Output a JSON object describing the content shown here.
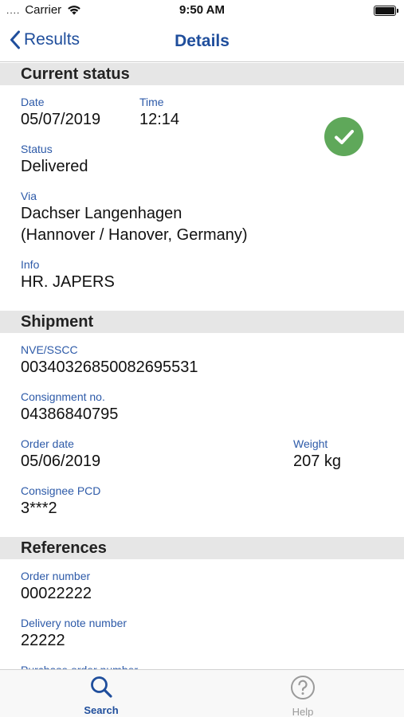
{
  "status_bar": {
    "dots": "....",
    "carrier": "Carrier",
    "time": "9:50 AM"
  },
  "nav": {
    "back_label": "Results",
    "title": "Details"
  },
  "current_status": {
    "header": "Current status",
    "date_label": "Date",
    "date_value": "05/07/2019",
    "time_label": "Time",
    "time_value": "12:14",
    "status_label": "Status",
    "status_value": "Delivered",
    "via_label": "Via",
    "via_line1": "Dachser Langenhagen",
    "via_line2": "(Hannover / Hanover, Germany)",
    "info_label": "Info",
    "info_value": "HR. JAPERS"
  },
  "shipment": {
    "header": "Shipment",
    "nve_label": "NVE/SSCC",
    "nve_value": "00340326850082695531",
    "consignment_label": "Consignment no.",
    "consignment_value": "04386840795",
    "order_date_label": "Order date",
    "order_date_value": "05/06/2019",
    "weight_label": "Weight",
    "weight_value": "207 kg",
    "pcd_label": "Consignee PCD",
    "pcd_value": "3***2"
  },
  "references": {
    "header": "References",
    "order_number_label": "Order number",
    "order_number_value": "00022222",
    "delivery_note_label": "Delivery note number",
    "delivery_note_value": "22222",
    "purchase_order_label": "Purchase order number"
  },
  "tabs": {
    "search_label": "Search",
    "help_label": "Help"
  },
  "colors": {
    "accent": "#1f4e9c",
    "success": "#5fa85a",
    "section_bg": "#e6e6e6"
  },
  "icons": {
    "back": "chevron-left-icon",
    "delivered": "checkmark-icon",
    "search": "search-icon",
    "help": "help-icon",
    "wifi": "wifi-icon",
    "battery": "battery-icon"
  }
}
